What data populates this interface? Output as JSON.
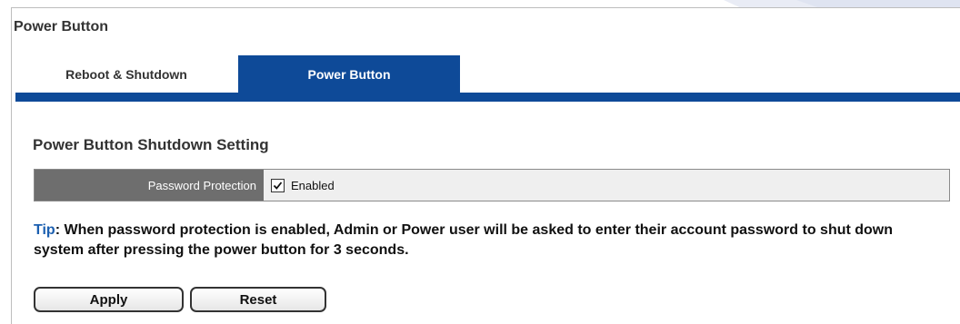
{
  "page": {
    "title": "Power Button"
  },
  "tabs": [
    {
      "label": "Reboot & Shutdown",
      "active": false
    },
    {
      "label": "Power Button",
      "active": true
    }
  ],
  "section": {
    "title": "Power Button Shutdown Setting"
  },
  "setting": {
    "label": "Password Protection",
    "checkbox_label": "Enabled",
    "checked": true
  },
  "tip": {
    "prefix": "Tip",
    "text": ": When password protection is enabled, Admin or Power user will be asked to enter their account password to shut down system after pressing the power button for 3 seconds."
  },
  "buttons": {
    "apply_label": "Apply",
    "reset_label": "Reset"
  },
  "colors": {
    "accent": "#0e4a98",
    "tip_prefix": "#1b5fb0",
    "label_bg": "#6e6e6e"
  }
}
